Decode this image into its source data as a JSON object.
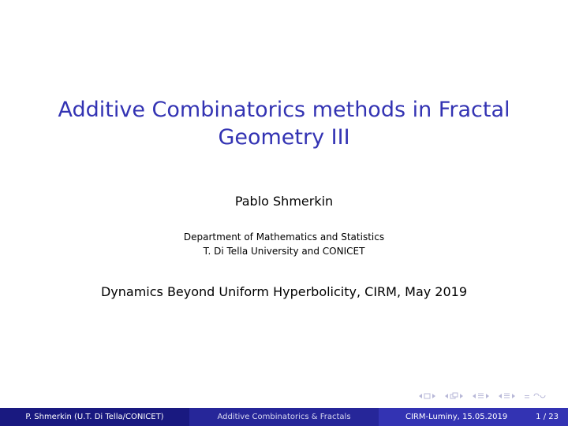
{
  "slide": {
    "title_line1": "Additive Combinatorics methods in Fractal",
    "title_line2": "Geometry III",
    "author": "Pablo Shmerkin",
    "institute_line1": "Department of Mathematics and Statistics",
    "institute_line2": "T. Di Tella University and CONICET",
    "date": "Dynamics Beyond Uniform Hyperbolicity, CIRM, May 2019"
  },
  "footer": {
    "author": "P. Shmerkin  (U.T. Di Tella/CONICET)",
    "short_title": "Additive Combinatorics & Fractals",
    "date": "CIRM-Luminy, 15.05.2019",
    "page": "1 / 23"
  },
  "navigation": {
    "icons": [
      "nav-frame-prev-icon",
      "nav-frame-next-icon",
      "nav-subsection-prev-icon",
      "nav-subsection-next-icon",
      "nav-section-prev-icon",
      "nav-section-next-icon",
      "nav-appendix-icon",
      "nav-search-icon"
    ],
    "icon_color": "#b8b8d8"
  },
  "colors": {
    "title": "#3333b3",
    "footer_left": "#191980",
    "footer_middle": "#262699",
    "footer_right": "#3333b3"
  }
}
